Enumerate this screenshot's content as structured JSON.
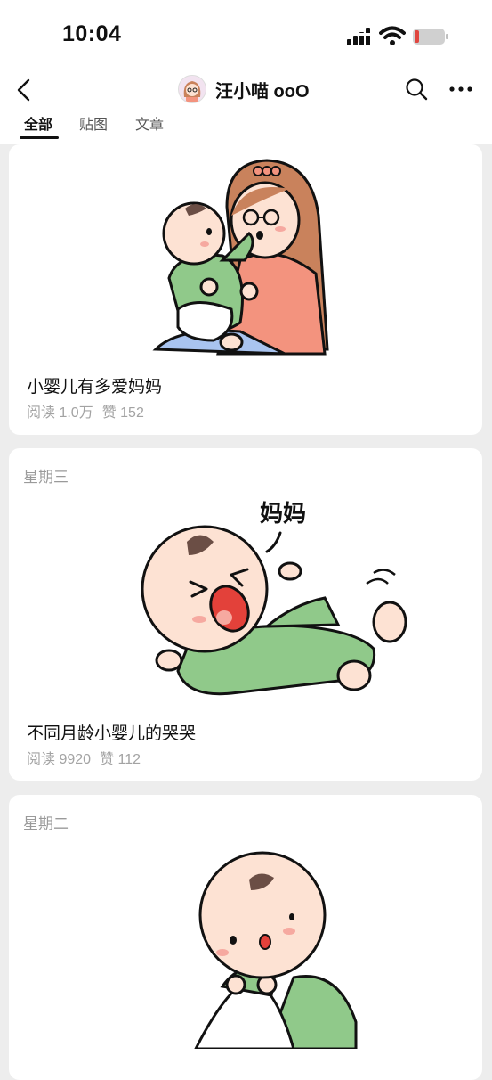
{
  "status_bar": {
    "time": "10:04"
  },
  "nav": {
    "account_name": "汪小喵 ooO"
  },
  "tabs": [
    {
      "label": "全部",
      "active": true
    },
    {
      "label": "贴图",
      "active": false
    },
    {
      "label": "文章",
      "active": false
    }
  ],
  "articles": [
    {
      "day": "",
      "title": "小婴儿有多爱妈妈",
      "reads": "阅读 1.0万",
      "likes": "赞 152"
    },
    {
      "day": "星期三",
      "title": "不同月龄小婴儿的哭哭",
      "reads": "阅读 9920",
      "likes": "赞 112",
      "illustration_text": "妈妈"
    },
    {
      "day": "星期二",
      "title": "",
      "reads": "",
      "likes": ""
    }
  ],
  "colors": {
    "baby_suit": "#90c98a",
    "mom_shirt": "#f3937e",
    "mom_hair": "#c9825c",
    "skin": "#fde2d3",
    "battery_level": "#e0463f"
  }
}
